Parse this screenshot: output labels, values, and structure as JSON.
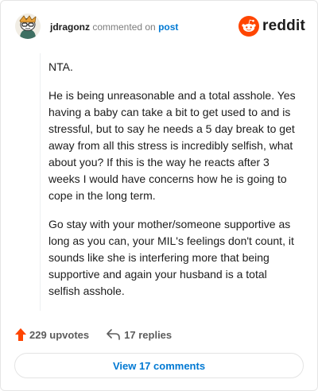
{
  "header": {
    "username": "jdragonz",
    "action_text": "commented on",
    "post_link": "post",
    "brand": "reddit",
    "icons": {
      "avatar": "snoo-avatar-icon",
      "logo": "reddit-logo-icon"
    }
  },
  "comment": {
    "paragraphs": [
      "NTA.",
      "He is being unreasonable and a total asshole. Yes having a baby can take a bit to get used to and is stressful, but to say he needs a 5 day break to get away from all this stress is incredibly selfish, what about you? If this is the way he reacts after 3 weeks I would have concerns how he is going to cope in the long term.",
      "Go stay with your mother/someone supportive as long as you can, your MIL's feelings don't count, it sounds like she is interfering more that being supportive and again your husband is a total selfish asshole."
    ]
  },
  "actions": {
    "upvotes_label": "229 upvotes",
    "replies_label": "17 replies",
    "icons": {
      "upvote": "upvote-arrow-icon",
      "reply": "reply-arrow-icon"
    }
  },
  "footer": {
    "view_comments_label": "View 17 comments"
  },
  "colors": {
    "accent": "#0079d3",
    "brand": "#ff4500",
    "upvote": "#ff4500"
  }
}
